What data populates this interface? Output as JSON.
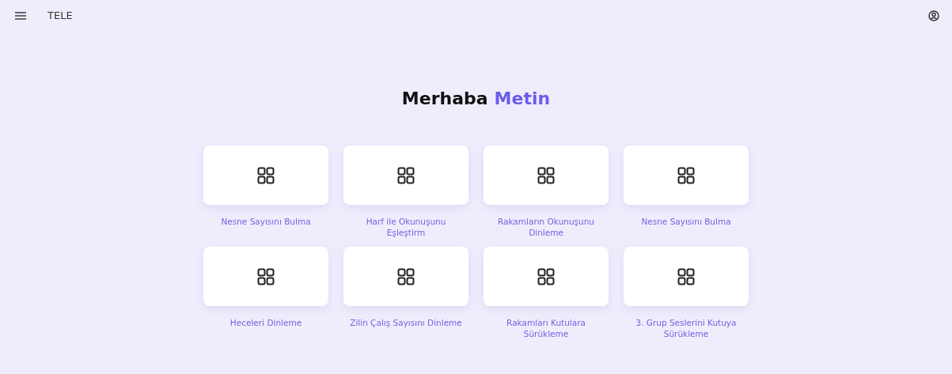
{
  "app_bar": {
    "title": "TELE"
  },
  "greeting": {
    "salutation": "Merhaba",
    "name": "Metin"
  },
  "cards": [
    {
      "label": "Nesne Sayısını Bulma"
    },
    {
      "label": "Harf ile Okunuşunu Eşleştirm"
    },
    {
      "label": "Rakamların Okunuşunu Dinleme"
    },
    {
      "label": "Nesne Sayısını Bulma"
    },
    {
      "label": "Heceleri Dinleme"
    },
    {
      "label": "Zilin Çalış Sayısını Dinleme"
    },
    {
      "label": "Rakamları Kutulara Sürükleme"
    },
    {
      "label": "3. Grup Seslerini Kutuya Sürükleme"
    }
  ]
}
